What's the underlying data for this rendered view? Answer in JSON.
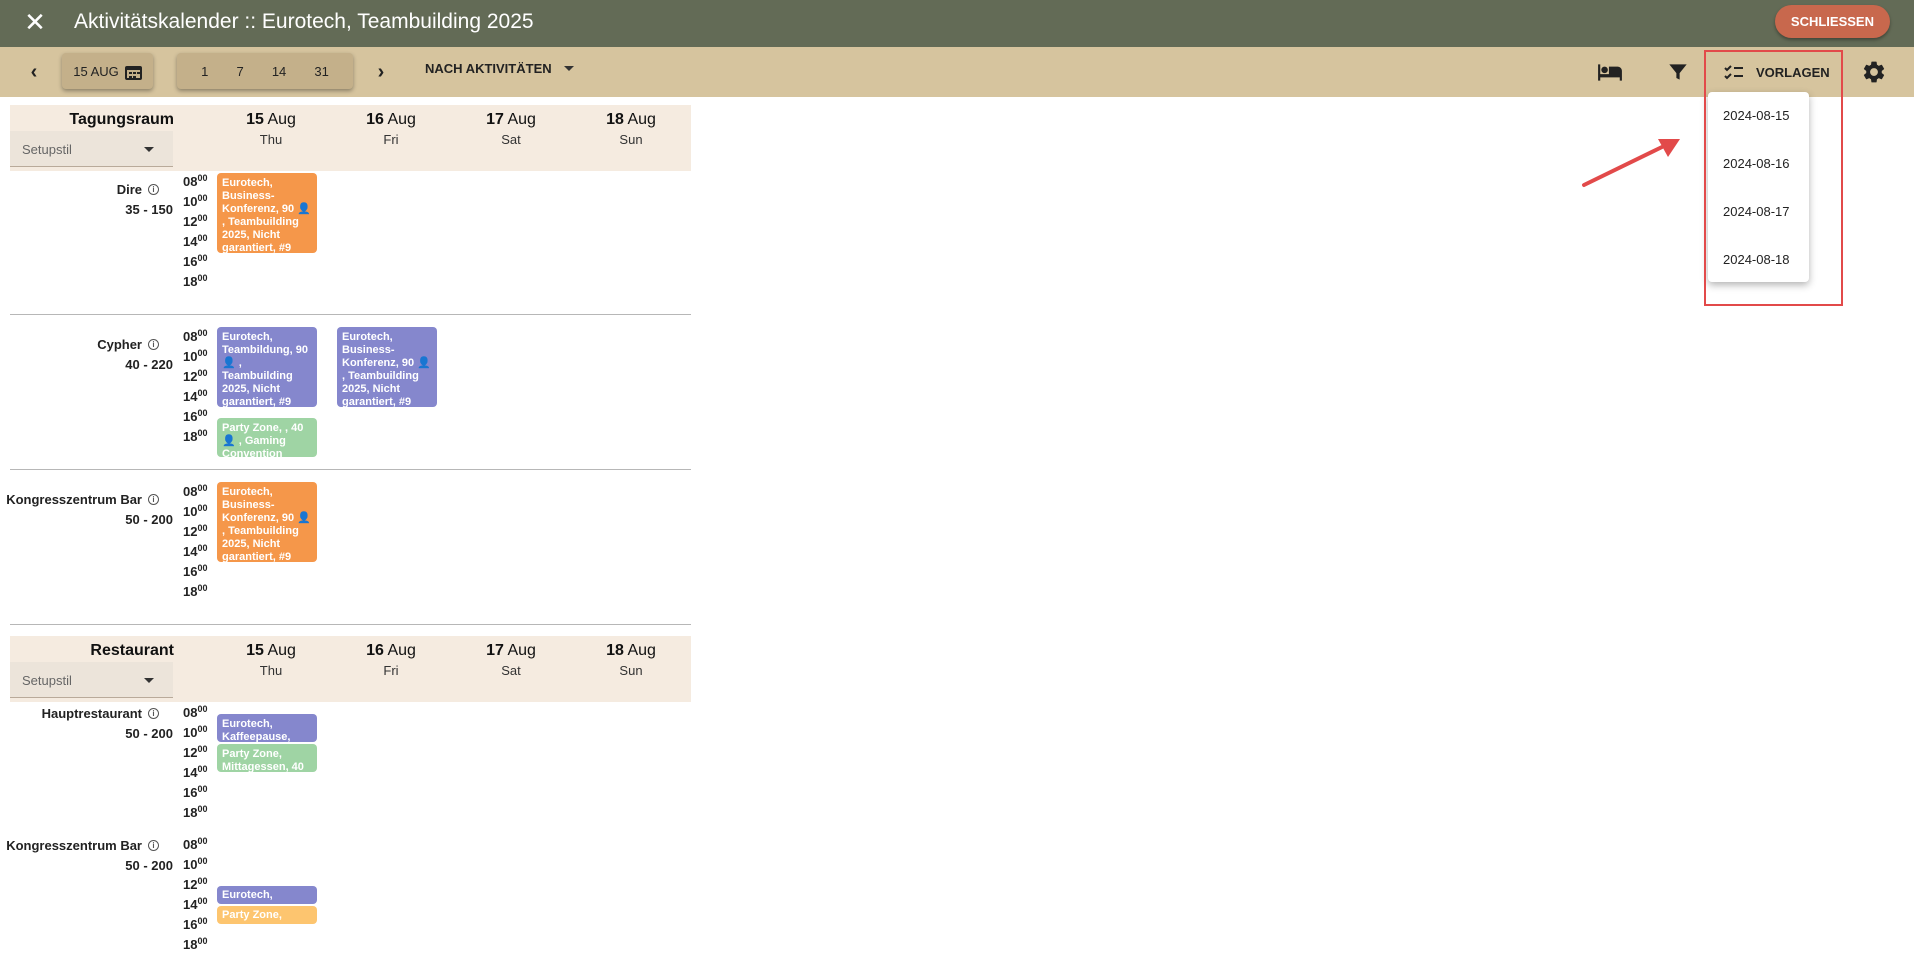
{
  "window": {
    "title": "Aktivitätskalender :: Eurotech, Teambuilding 2025",
    "close_label": "SCHLIESSEN"
  },
  "toolbar": {
    "date_label": "15 AUG",
    "ranges": [
      "1",
      "7",
      "14",
      "31"
    ],
    "sort_label": "NACH AKTIVITÄTEN",
    "vorlagen_label": "VORLAGEN"
  },
  "dropdown": {
    "items": [
      "2024-08-15",
      "2024-08-16",
      "2024-08-17",
      "2024-08-18"
    ]
  },
  "days": [
    {
      "day": "15",
      "month": "Aug",
      "weekday": "Thu"
    },
    {
      "day": "16",
      "month": "Aug",
      "weekday": "Fri"
    },
    {
      "day": "17",
      "month": "Aug",
      "weekday": "Sat"
    },
    {
      "day": "18",
      "month": "Aug",
      "weekday": "Sun"
    }
  ],
  "times": [
    "08",
    "10",
    "12",
    "14",
    "16",
    "18"
  ],
  "time_suffix": "00",
  "sections": [
    {
      "title": "Tagungsraum",
      "setup_placeholder": "Setupstil",
      "rooms": [
        {
          "name": "Dire",
          "capacity": "35 - 150",
          "events": [
            {
              "text": "Eurotech, Business-Konferenz, 90 👤 , Teambuilding 2025, Nicht garantiert, #9",
              "color": "orange"
            }
          ]
        },
        {
          "name": "Cypher",
          "capacity": "40 - 220",
          "events": [
            {
              "text": "Eurotech, Teambildung, 90 👤 , Teambuilding 2025, Nicht garantiert, #9",
              "color": "blue"
            },
            {
              "text": "Eurotech, Business-Konferenz, 90 👤 , Teambuilding 2025, Nicht garantiert, #9",
              "color": "blue"
            },
            {
              "text": "Party Zone, , 40 👤 , Gaming Convention",
              "color": "green"
            }
          ]
        },
        {
          "name": "Kongresszentrum Bar",
          "capacity": "50 - 200",
          "events": [
            {
              "text": "Eurotech, Business-Konferenz, 90 👤 , Teambuilding 2025, Nicht garantiert, #9",
              "color": "orange"
            }
          ]
        }
      ]
    },
    {
      "title": "Restaurant",
      "setup_placeholder": "Setupstil",
      "rooms": [
        {
          "name": "Hauptrestaurant",
          "capacity": "50 - 200",
          "events": [
            {
              "text": "Eurotech, Kaffeepause,",
              "color": "blue"
            },
            {
              "text": "Party Zone, Mittagessen, 40",
              "color": "green"
            }
          ]
        },
        {
          "name": "Kongresszentrum Bar",
          "capacity": "50 - 200",
          "events": [
            {
              "text": "Eurotech,",
              "color": "blue"
            },
            {
              "text": "Party Zone,",
              "color": "amber"
            }
          ]
        }
      ]
    }
  ],
  "colors": {
    "titlebar": "#636b56",
    "toolbar": "#d6c49e",
    "header_bg": "#f5ebe0",
    "orange": "#f5974a",
    "blue": "#8587cd",
    "green": "#9fd4a4",
    "amber": "#fdc56f",
    "close_button": "#c8684d",
    "highlight": "#e24a4a"
  },
  "icons": [
    "close-icon",
    "chevron-left-icon",
    "calendar-icon",
    "chevron-right-icon",
    "caret-down-icon",
    "bed-icon",
    "filter-icon",
    "checklist-icon",
    "gear-icon",
    "info-icon",
    "person-icon"
  ]
}
